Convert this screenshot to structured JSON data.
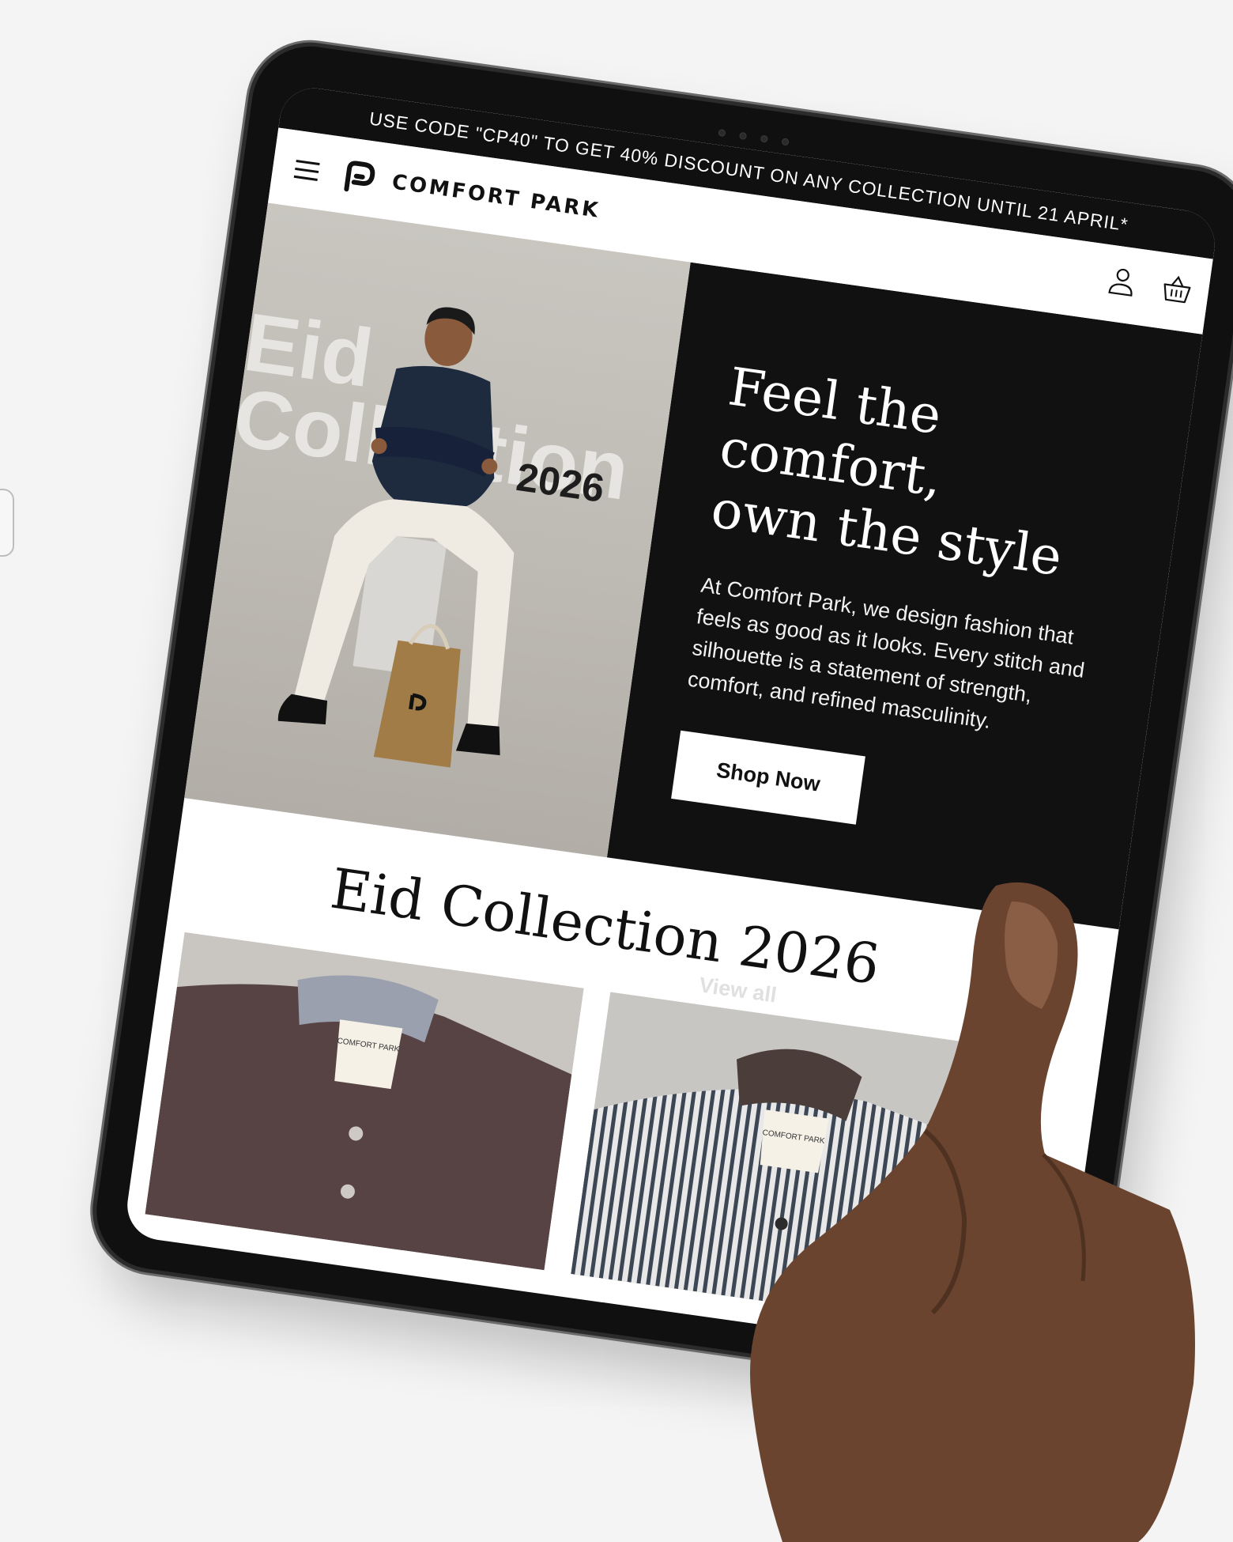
{
  "announcement": {
    "text": "USE CODE \"CP40\" TO GET 40% DISCOUNT ON ANY COLLECTION UNTIL 21 APRIL*"
  },
  "header": {
    "brand": "COMFORT PARK",
    "icons": [
      "menu-icon",
      "comfort-park-logo",
      "account-icon",
      "cart-icon"
    ]
  },
  "hero": {
    "image_text_line1": "Eid",
    "image_text_line2": "Collection",
    "image_year": "2026",
    "title_line1": "Feel the comfort,",
    "title_line2": "own the style",
    "body": "At Comfort Park, we design fashion that feels as good as it looks. Every stitch and silhouette is a statement of strength, comfort, and refined masculinity.",
    "cta_label": "Shop Now"
  },
  "collection": {
    "title": "Eid Collection 2026",
    "view_all_label": "View all",
    "products": [
      {
        "image": "maroon-band-collar-shirt",
        "tag_text": "COMFORT PARK"
      },
      {
        "image": "striped-band-collar-shirt",
        "tag_text": "COMFORT PARK"
      }
    ]
  },
  "colors": {
    "background": "#f4f4f4",
    "device_frame": "#101010",
    "hero_panel": "#111111",
    "accent_text": "#ffffff",
    "skin": "#6b4430"
  }
}
